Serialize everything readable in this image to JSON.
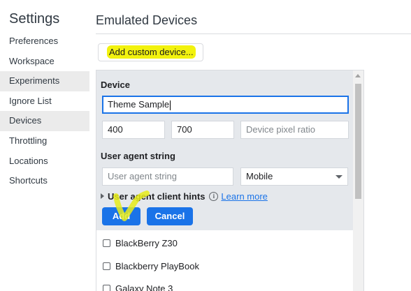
{
  "app": {
    "title": "Settings"
  },
  "sidebar": {
    "items": [
      {
        "label": "Preferences"
      },
      {
        "label": "Workspace"
      },
      {
        "label": "Experiments"
      },
      {
        "label": "Ignore List"
      },
      {
        "label": "Devices"
      },
      {
        "label": "Throttling"
      },
      {
        "label": "Locations"
      },
      {
        "label": "Shortcuts"
      }
    ],
    "selected": "Devices"
  },
  "main": {
    "title": "Emulated Devices",
    "add_custom_label": "Add custom device..."
  },
  "editor": {
    "device_heading": "Device",
    "device_name_value": "Theme Sample",
    "width_value": "400",
    "height_value": "700",
    "dpr_placeholder": "Device pixel ratio",
    "ua_heading": "User agent string",
    "ua_placeholder": "User agent string",
    "ua_type_value": "Mobile",
    "hints_label": "User agent client hints",
    "info_icon": "info-icon",
    "learn_more": "Learn more",
    "add_label": "Add",
    "cancel_label": "Cancel"
  },
  "devices": [
    {
      "label": "BlackBerry Z30",
      "checked": false
    },
    {
      "label": "Blackberry PlayBook",
      "checked": false
    },
    {
      "label": "Galaxy Note 3",
      "checked": false
    }
  ],
  "colors": {
    "accent": "#1a73e8",
    "highlight": "#f2f20e",
    "selected_bg": "#ebebeb",
    "editor_bg": "#e5e8ec"
  }
}
